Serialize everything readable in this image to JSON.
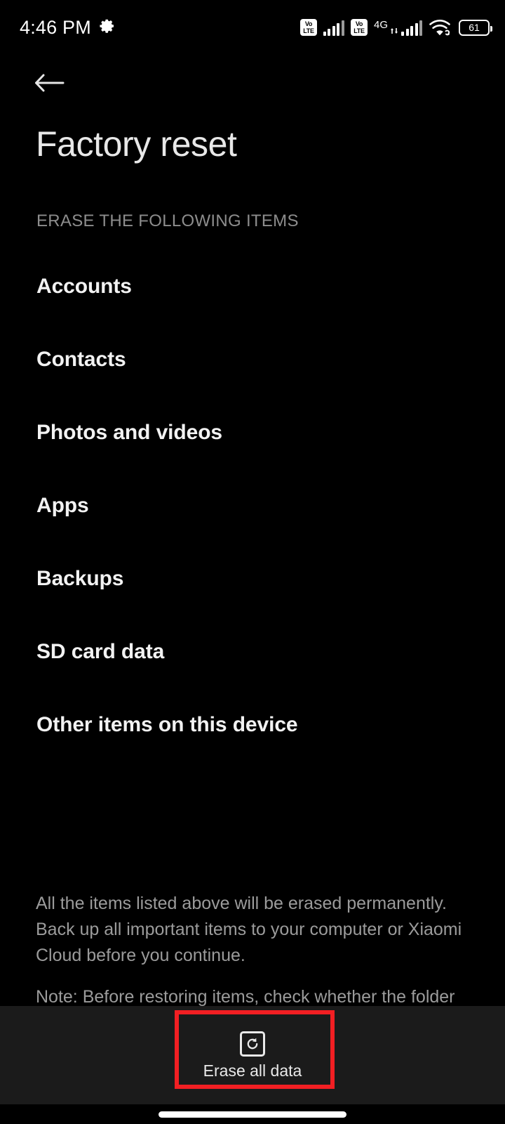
{
  "status_bar": {
    "time": "4:46 PM",
    "gear_icon": "gear-icon",
    "sim1_volte": "VoLTE",
    "volte_line1": "Vo",
    "volte_line2": "LTE",
    "sim2_volte": "VoLTE",
    "network_type": "4G",
    "wifi_icon": "wifi-icon",
    "battery_percent": "61"
  },
  "nav": {
    "back_icon": "back-arrow-icon"
  },
  "header": {
    "title": "Factory reset"
  },
  "section": {
    "label": "ERASE THE FOLLOWING ITEMS",
    "items": [
      {
        "label": "Accounts"
      },
      {
        "label": "Contacts"
      },
      {
        "label": "Photos and videos"
      },
      {
        "label": "Apps"
      },
      {
        "label": "Backups"
      },
      {
        "label": "SD card data"
      },
      {
        "label": "Other items on this device"
      }
    ]
  },
  "footer": {
    "paragraph1": "All the items listed above will be erased permanently. Back up all important items to your computer or Xiaomi Cloud before you continue.",
    "paragraph2": "Note: Before restoring items, check whether the folder"
  },
  "bottom_bar": {
    "erase_button_label": "Erase all data",
    "erase_button_icon": "factory-reset-icon"
  },
  "system": {
    "home_indicator": "home-indicator"
  },
  "colors": {
    "background": "#000000",
    "bottom_bar": "#1b1b1b",
    "highlight": "#f21f23",
    "primary_text": "#f2f2f2",
    "secondary_text": "#9b9b9b",
    "title_text": "#e8e8e8"
  }
}
